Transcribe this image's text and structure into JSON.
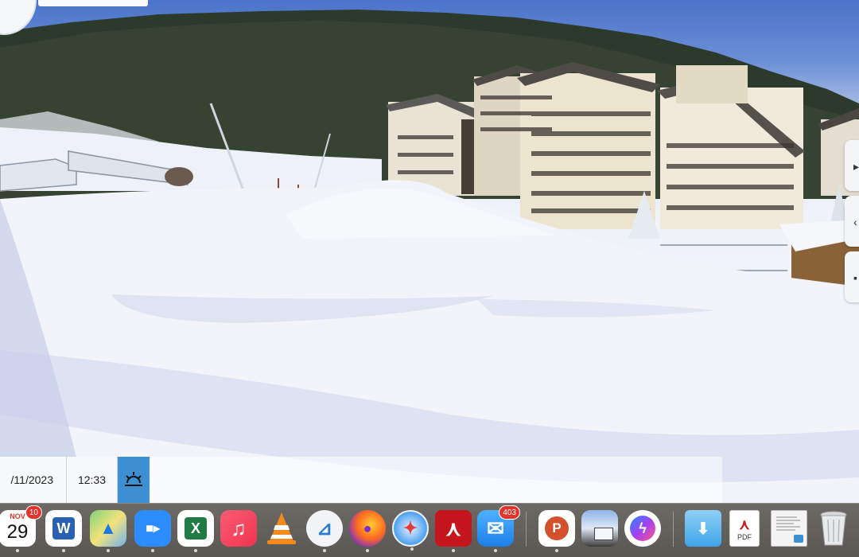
{
  "webcam": {
    "date": "/11/2023",
    "time": "12:33",
    "weather_icon": "sunrise-icon"
  },
  "dock": {
    "apps": [
      {
        "name": "Calendar",
        "month": "NOV",
        "day": "29",
        "badge": "10"
      },
      {
        "name": "Microsoft Word",
        "glyph": "W"
      },
      {
        "name": "Maps",
        "glyph": "▲"
      },
      {
        "name": "Zoom",
        "glyph": "■▸"
      },
      {
        "name": "Microsoft Excel",
        "glyph": "X"
      },
      {
        "name": "Music",
        "glyph": "♫"
      },
      {
        "name": "VLC",
        "glyph": "▲"
      },
      {
        "name": "Preview",
        "glyph": "⊿"
      },
      {
        "name": "Firefox",
        "glyph": "●"
      },
      {
        "name": "Safari",
        "glyph": "✦"
      },
      {
        "name": "Adobe Acrobat",
        "glyph": "⋏"
      },
      {
        "name": "Mail",
        "glyph": "✉",
        "badge": "403"
      },
      {
        "name": "Microsoft PowerPoint",
        "glyph": "P"
      },
      {
        "name": "Photos Preview",
        "glyph": ""
      },
      {
        "name": "Messenger",
        "glyph": "ϟ"
      },
      {
        "name": "Downloads",
        "glyph": "⬇"
      },
      {
        "name": "PDF Document",
        "label": "PDF"
      },
      {
        "name": "Document",
        "glyph": ""
      },
      {
        "name": "Trash",
        "glyph": ""
      }
    ]
  },
  "colors": {
    "word": "#2b5fb4",
    "excel": "#1f7a43",
    "powerpoint": "#d2502b",
    "acrobat": "#c4161c",
    "zoom": "#2d8cff",
    "music": "#f0344e",
    "firefox": "#ff6a1f",
    "messenger": "#7b3ff2"
  }
}
